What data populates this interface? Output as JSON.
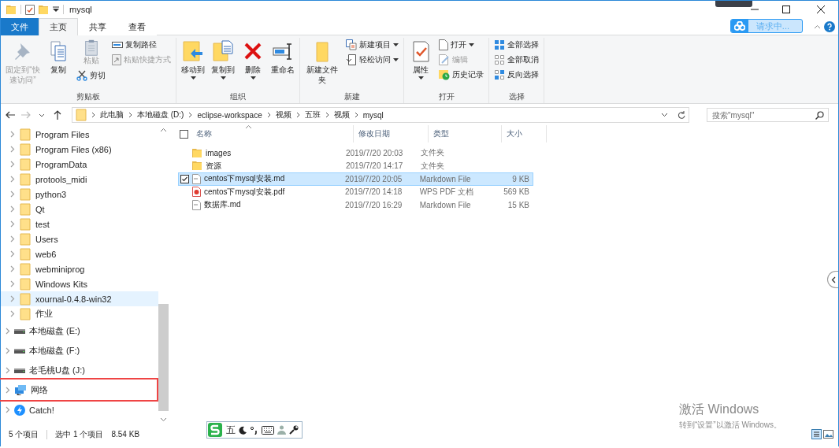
{
  "window": {
    "title": "mysql"
  },
  "ribbon_tabs": [
    {
      "label": "文件",
      "kind": "file",
      "selected": false
    },
    {
      "label": "主页",
      "kind": "tab",
      "selected": true
    },
    {
      "label": "共享",
      "kind": "tab",
      "selected": false
    },
    {
      "label": "查看",
      "kind": "tab",
      "selected": false
    }
  ],
  "cloud_button": {
    "label": "请求中..."
  },
  "ribbon_groups": [
    {
      "label": "剪贴板",
      "columns": [
        [
          {
            "label": "固定到“快速访问”",
            "kind": "large",
            "disabled": true,
            "dropdown": false
          }
        ],
        [
          {
            "label": "复制",
            "kind": "large",
            "disabled": false,
            "dropdown": false
          }
        ],
        [
          {
            "label": "粘贴",
            "kind": "compact",
            "disabled": true,
            "dropdown": false
          },
          {
            "label": "剪切",
            "kind": "small",
            "disabled": false,
            "dropdown": false
          }
        ],
        [
          {
            "label": "复制路径",
            "kind": "small",
            "disabled": false,
            "dropdown": false
          },
          {
            "label": "粘贴快捷方式",
            "kind": "small",
            "disabled": true,
            "dropdown": false
          }
        ]
      ]
    },
    {
      "label": "组织",
      "columns": [
        [
          {
            "label": "移动到",
            "kind": "large",
            "disabled": false,
            "dropdown": true
          }
        ],
        [
          {
            "label": "复制到",
            "kind": "large",
            "disabled": false,
            "dropdown": true
          }
        ],
        [
          {
            "label": "删除",
            "kind": "large",
            "disabled": false,
            "dropdown": true
          }
        ],
        [
          {
            "label": "重命名",
            "kind": "large",
            "disabled": false,
            "dropdown": false
          }
        ]
      ]
    },
    {
      "label": "新建",
      "columns": [
        [
          {
            "label": "新建文件夹",
            "kind": "large",
            "disabled": false,
            "dropdown": false
          }
        ],
        [
          {
            "label": "新建项目",
            "kind": "small",
            "disabled": false,
            "dropdown": true
          },
          {
            "label": "轻松访问",
            "kind": "small",
            "disabled": false,
            "dropdown": true
          }
        ]
      ]
    },
    {
      "label": "打开",
      "columns": [
        [
          {
            "label": "属性",
            "kind": "large",
            "disabled": false,
            "dropdown": true
          }
        ],
        [
          {
            "label": "打开",
            "kind": "small",
            "disabled": false,
            "dropdown": true
          },
          {
            "label": "编辑",
            "kind": "small",
            "disabled": true,
            "dropdown": false
          },
          {
            "label": "历史记录",
            "kind": "small",
            "disabled": false,
            "dropdown": false
          }
        ]
      ]
    },
    {
      "label": "选择",
      "columns": [
        [
          {
            "label": "全部选择",
            "kind": "small",
            "disabled": false,
            "dropdown": false
          },
          {
            "label": "全部取消",
            "kind": "small",
            "disabled": false,
            "dropdown": false
          },
          {
            "label": "反向选择",
            "kind": "small",
            "disabled": false,
            "dropdown": false
          }
        ]
      ]
    }
  ],
  "address_bar": {
    "path": [
      "此电脑",
      "本地磁盘 (D:)",
      "eclipse-workspace",
      "视频",
      "五班",
      "视频",
      "mysql"
    ]
  },
  "search": {
    "placeholder": "搜索\"mysql\""
  },
  "nav_tree": [
    {
      "label": "Program Files",
      "kind": "folder",
      "selected": false,
      "highlighted": false
    },
    {
      "label": "Program Files (x86)",
      "kind": "folder",
      "selected": false,
      "highlighted": false
    },
    {
      "label": "ProgramData",
      "kind": "folder",
      "selected": false,
      "highlighted": false
    },
    {
      "label": "protools_midi",
      "kind": "folder",
      "selected": false,
      "highlighted": false
    },
    {
      "label": "python3",
      "kind": "folder",
      "selected": false,
      "highlighted": false
    },
    {
      "label": "Qt",
      "kind": "folder",
      "selected": false,
      "highlighted": false
    },
    {
      "label": "test",
      "kind": "folder",
      "selected": false,
      "highlighted": false
    },
    {
      "label": "Users",
      "kind": "folder",
      "selected": false,
      "highlighted": false
    },
    {
      "label": "web6",
      "kind": "folder",
      "selected": false,
      "highlighted": false
    },
    {
      "label": "webminiprog",
      "kind": "folder",
      "selected": false,
      "highlighted": false
    },
    {
      "label": "Windows Kits",
      "kind": "folder",
      "selected": false,
      "highlighted": false
    },
    {
      "label": "xournal-0.4.8-win32",
      "kind": "folder",
      "selected": true,
      "highlighted": false
    },
    {
      "label": "作业",
      "kind": "folder",
      "selected": false,
      "highlighted": false
    },
    {
      "label": "本地磁盘 (E:)",
      "kind": "drive",
      "selected": false,
      "highlighted": false
    },
    {
      "label": "本地磁盘 (F:)",
      "kind": "drive",
      "selected": false,
      "highlighted": false
    },
    {
      "label": "老毛桃U盘 (J:)",
      "kind": "drive",
      "selected": false,
      "highlighted": false
    },
    {
      "label": "网络",
      "kind": "network",
      "selected": false,
      "highlighted": true
    },
    {
      "label": "Catch!",
      "kind": "app",
      "selected": false,
      "highlighted": false
    }
  ],
  "file_list": {
    "select_all_checked": false,
    "columns": [
      "名称",
      "修改日期",
      "类型",
      "大小"
    ],
    "rows": [
      {
        "kind": "folder",
        "name": "images",
        "modified": "2019/7/20 20:03",
        "type": "文件夹",
        "selected": false,
        "checked": false
      },
      {
        "kind": "folder",
        "name": "资源",
        "modified": "2019/7/20 14:17",
        "type": "文件夹",
        "selected": false,
        "checked": false
      },
      {
        "kind": "md",
        "name": "centos下mysql安装.md",
        "modified": "2019/7/20 20:05",
        "type": "Markdown File",
        "size": "9 KB",
        "selected": true,
        "checked": true
      },
      {
        "kind": "pdf",
        "name": "centos下mysql安装.pdf",
        "modified": "2019/7/20 14:18",
        "type": "WPS PDF 文档",
        "size": "569 KB",
        "selected": false,
        "checked": false
      },
      {
        "kind": "md",
        "name": "数据库.md",
        "modified": "2019/7/20 16:29",
        "type": "Markdown File",
        "size": "15 KB",
        "selected": false,
        "checked": false
      }
    ]
  },
  "status_bar": {
    "count": "5 个项目",
    "selection": "选中 1 个项目",
    "size": "8.54 KB"
  },
  "activation": {
    "title": "激活 Windows",
    "message": "转到“设置”以激活 Windows。"
  },
  "ime_toolbar": {
    "mode": "五"
  }
}
